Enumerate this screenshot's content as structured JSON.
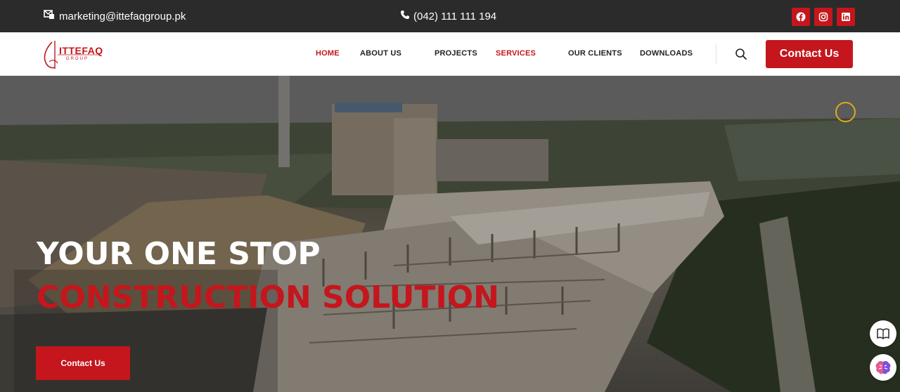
{
  "topbar": {
    "email": "marketing@ittefaqgroup.pk",
    "phone": "(042) 111 111 194",
    "socials": [
      "facebook-icon",
      "instagram-icon",
      "linkedin-icon"
    ]
  },
  "header": {
    "logo_text": "ITTEFAQ",
    "logo_sub": "GROUP",
    "nav": [
      {
        "label": "HOME",
        "active": true
      },
      {
        "label": "ABOUT US",
        "active": false
      },
      {
        "label": "PROJECTS",
        "active": false
      },
      {
        "label": "SERVICES",
        "active": true
      },
      {
        "label": "OUR CLIENTS",
        "active": false
      },
      {
        "label": "DOWNLOADS",
        "active": false
      }
    ],
    "contact_label": "Contact Us"
  },
  "hero": {
    "headline_line1": "YOUR ONE STOP",
    "headline_line2": "CONSTRUCTION SOLUTION",
    "button_label": "Contact Us"
  },
  "colors": {
    "brand_red": "#c4161c",
    "topbar_bg": "#2b2b2b",
    "accent_ring": "#e0a81a"
  }
}
